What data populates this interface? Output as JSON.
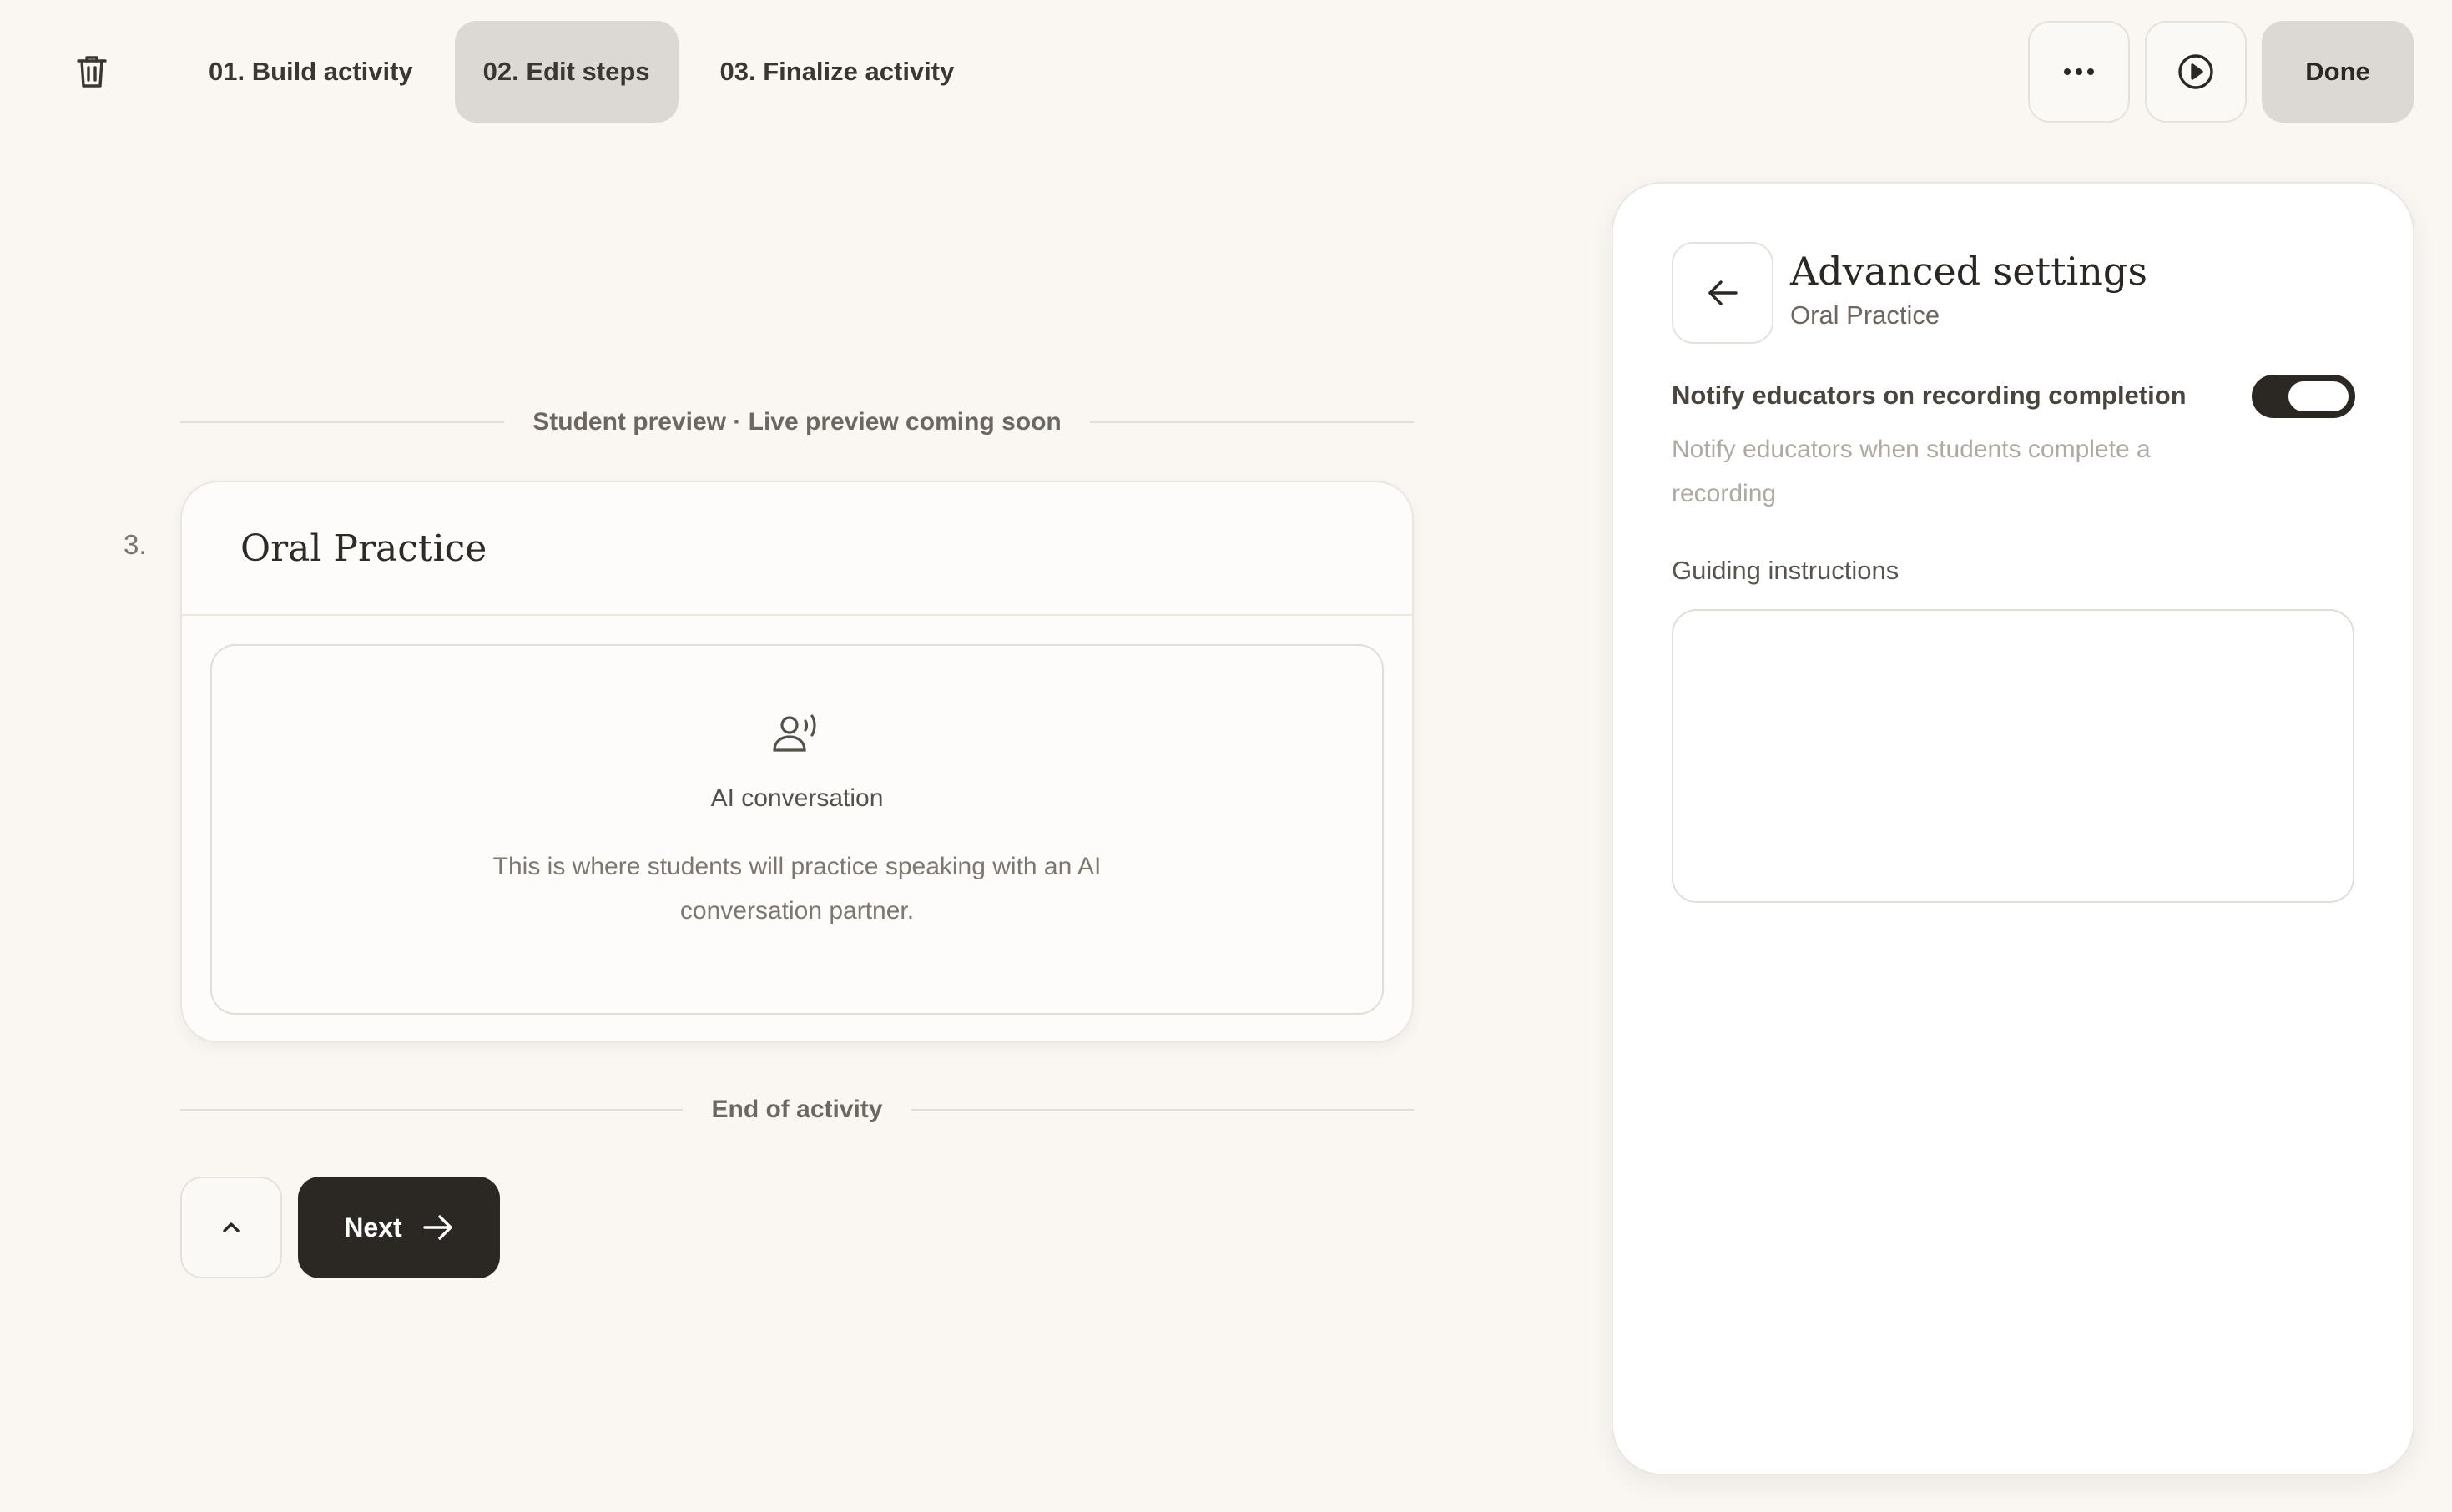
{
  "toolbar": {
    "delete_icon": "trash-icon",
    "steps": [
      {
        "label": "01. Build activity",
        "active": false
      },
      {
        "label": "02. Edit steps",
        "active": true
      },
      {
        "label": "03. Finalize activity",
        "active": false
      }
    ],
    "more_icon": "more-horizontal-icon",
    "preview_icon": "play-circle-icon",
    "done_label": "Done"
  },
  "preview": {
    "header_label": "Student preview · Live preview coming soon",
    "step_number": "3.",
    "card_title": "Oral Practice",
    "ai_icon": "person-speaking-icon",
    "ai_label": "AI conversation",
    "ai_description": "This is where students will practice speaking with an AI conversation partner.",
    "end_label": "End of activity",
    "up_icon": "chevron-up-icon",
    "next_label": "Next",
    "next_icon": "arrow-right-icon"
  },
  "settings": {
    "back_icon": "arrow-left-icon",
    "title": "Advanced settings",
    "subtitle": "Oral Practice",
    "notify_label": "Notify educators on recording completion",
    "notify_enabled": true,
    "notify_description": "Notify educators when students complete a recording",
    "guiding_label": "Guiding instructions",
    "guiding_value": "",
    "guiding_placeholder": ""
  },
  "colors": {
    "background": "#faf7f3",
    "primary_dark": "#2b2723",
    "active_tab": "#dcd8d3",
    "border": "#e2ddd7"
  }
}
